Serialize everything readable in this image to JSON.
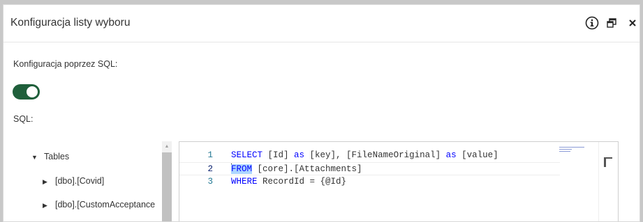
{
  "dialog": {
    "title": "Konfiguracja listy wyboru",
    "icons": [
      "info-icon",
      "restore-window-icon",
      "close-icon"
    ]
  },
  "form": {
    "sql_config_label": "Konfiguracja poprzez SQL:",
    "sql_config_enabled": true,
    "sql_label": "SQL:"
  },
  "tree": {
    "root": "Tables",
    "items": [
      "[dbo].[Covid]",
      "[dbo].[CustomAcceptance"
    ]
  },
  "editor": {
    "active_line": 2,
    "lines": [
      {
        "number": "1",
        "tokens": [
          {
            "text": "SELECT",
            "type": "keyword"
          },
          {
            "text": " [Id] ",
            "type": "text"
          },
          {
            "text": "as",
            "type": "keyword"
          },
          {
            "text": " [key], [FileNameOriginal] ",
            "type": "text"
          },
          {
            "text": "as",
            "type": "keyword"
          },
          {
            "text": " [value]",
            "type": "text"
          }
        ]
      },
      {
        "number": "2",
        "tokens": [
          {
            "text": "FROM",
            "type": "keyword"
          },
          {
            "text": " [core].[Attachments]",
            "type": "text"
          }
        ]
      },
      {
        "number": "3",
        "tokens": [
          {
            "text": "WHERE",
            "type": "keyword"
          },
          {
            "text": " RecordId = {@Id}",
            "type": "text"
          }
        ]
      }
    ]
  },
  "colors": {
    "toggle_on": "#1f5f3b",
    "keyword": "#0000ff",
    "line_number": "#237893"
  }
}
